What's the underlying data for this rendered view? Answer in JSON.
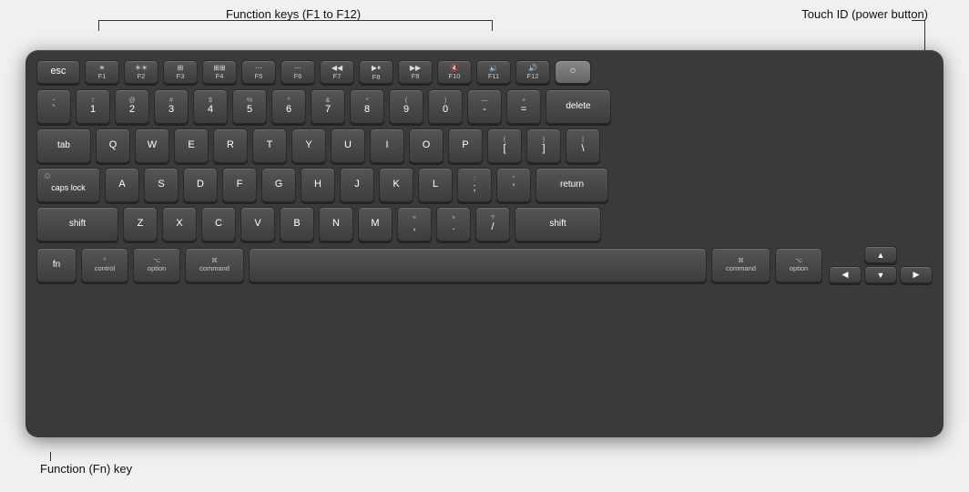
{
  "annotations": {
    "function_keys_label": "Function keys (F1 to F12)",
    "touch_id_label": "Touch ID (power button)",
    "fn_key_label": "Function (Fn) key"
  },
  "keyboard": {
    "rows": {
      "fn_row": [
        "esc",
        "F1",
        "F2",
        "F3",
        "F4",
        "F5",
        "F6",
        "F7",
        "F8",
        "F9",
        "F10",
        "F11",
        "F12",
        "touch_id"
      ],
      "number_row": [
        "~`",
        "!1",
        "@2",
        "#3",
        "$4",
        "%5",
        "^6",
        "&7",
        "*8",
        "(9",
        ")0",
        "-",
        "=+",
        "delete"
      ],
      "tab_row": [
        "tab",
        "Q",
        "W",
        "E",
        "R",
        "T",
        "Y",
        "U",
        "I",
        "O",
        "P",
        "[{",
        "}]",
        "|\\"
      ],
      "caps_row": [
        "caps lock",
        "A",
        "S",
        "D",
        "F",
        "G",
        "H",
        "J",
        "K",
        "L",
        ";:",
        "'\"",
        "return"
      ],
      "shift_row": [
        "shift",
        "Z",
        "X",
        "C",
        "V",
        "B",
        "N",
        "M",
        ",<",
        ".>",
        "/?",
        "shift"
      ],
      "bottom_row": [
        "fn",
        "control",
        "option",
        "command",
        "space",
        "command",
        "option",
        "arrows"
      ]
    }
  }
}
